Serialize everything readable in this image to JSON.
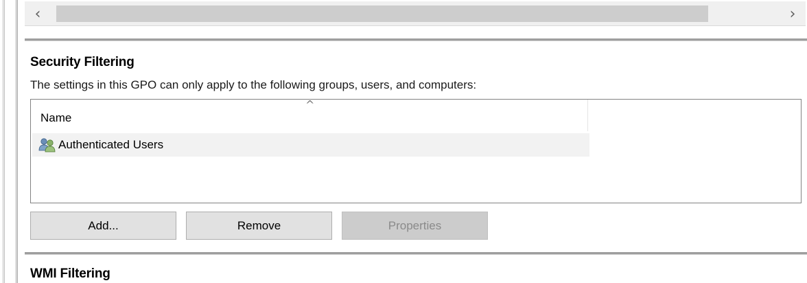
{
  "scrollbar": {
    "left_arrow": "‹",
    "right_arrow": "›"
  },
  "security_filtering": {
    "title": "Security Filtering",
    "description": "The settings in this GPO can only apply to the following groups, users, and computers:",
    "list": {
      "columns": [
        "Name"
      ],
      "sort_indicator": "^",
      "items": [
        {
          "name": "Authenticated Users",
          "icon": "users-icon"
        }
      ]
    },
    "buttons": {
      "add": "Add...",
      "remove": "Remove",
      "properties": "Properties"
    }
  },
  "wmi_filtering": {
    "title": "WMI Filtering"
  }
}
